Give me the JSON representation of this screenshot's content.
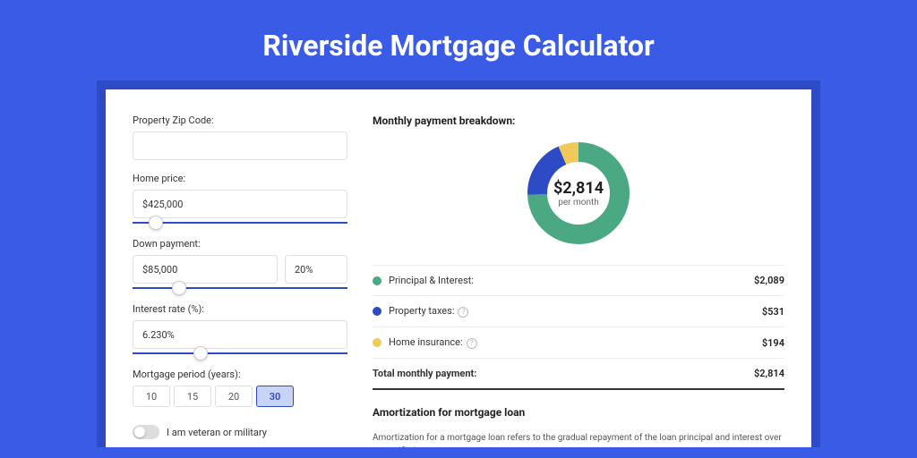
{
  "title": "Riverside Mortgage Calculator",
  "form": {
    "zip_label": "Property Zip Code:",
    "zip_value": "",
    "price_label": "Home price:",
    "price_value": "$425,000",
    "down_label": "Down payment:",
    "down_value": "$85,000",
    "down_pct": "20%",
    "rate_label": "Interest rate (%):",
    "rate_value": "6.230%",
    "period_label": "Mortgage period (years):",
    "periods": [
      "10",
      "15",
      "20",
      "30"
    ],
    "veteran_label": "I am veteran or military"
  },
  "breakdown": {
    "heading": "Monthly payment breakdown:",
    "center_total": "$2,814",
    "center_label": "per month",
    "items": [
      {
        "label": "Principal & Interest:",
        "value": "$2,089"
      },
      {
        "label": "Property taxes:",
        "value": "$531",
        "help": true
      },
      {
        "label": "Home insurance:",
        "value": "$194",
        "help": true
      }
    ],
    "total_label": "Total monthly payment:",
    "total_value": "$2,814"
  },
  "amort": {
    "heading": "Amortization for mortgage loan",
    "text": "Amortization for a mortgage loan refers to the gradual repayment of the loan principal and interest over a specified"
  },
  "chart_data": {
    "type": "pie",
    "title": "Monthly payment breakdown",
    "categories": [
      "Principal & Interest",
      "Property taxes",
      "Home insurance"
    ],
    "values": [
      2089,
      531,
      194
    ],
    "colors": [
      "#4aa882",
      "#2e4bc6",
      "#f0c95a"
    ]
  }
}
